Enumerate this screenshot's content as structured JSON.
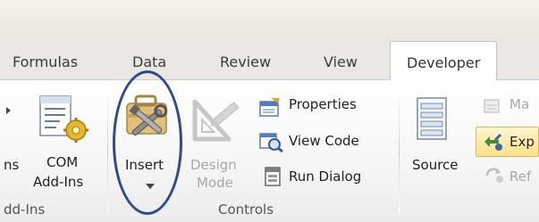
{
  "tabs": [
    {
      "label": "Formulas"
    },
    {
      "label": "Data"
    },
    {
      "label": "Review"
    },
    {
      "label": "View"
    },
    {
      "label": "Developer",
      "active": true
    }
  ],
  "addins_group": {
    "partial_button": "ns",
    "com_button": {
      "line1": "COM",
      "line2": "Add-Ins"
    },
    "label": "dd-Ins"
  },
  "controls_group": {
    "insert_button": "Insert",
    "design_mode": {
      "line1": "Design",
      "line2": "Mode"
    },
    "properties": "Properties",
    "view_code": "View Code",
    "run_dialog": "Run Dialog",
    "label": "Controls"
  },
  "xml_group": {
    "source_button": "Source",
    "map_properties": "Ma",
    "expansion_packs": "Exp",
    "refresh_data": "Ref"
  },
  "colors": {
    "highlight_oval": "#2d4b8e",
    "disabled_text": "#a8a8a8"
  }
}
